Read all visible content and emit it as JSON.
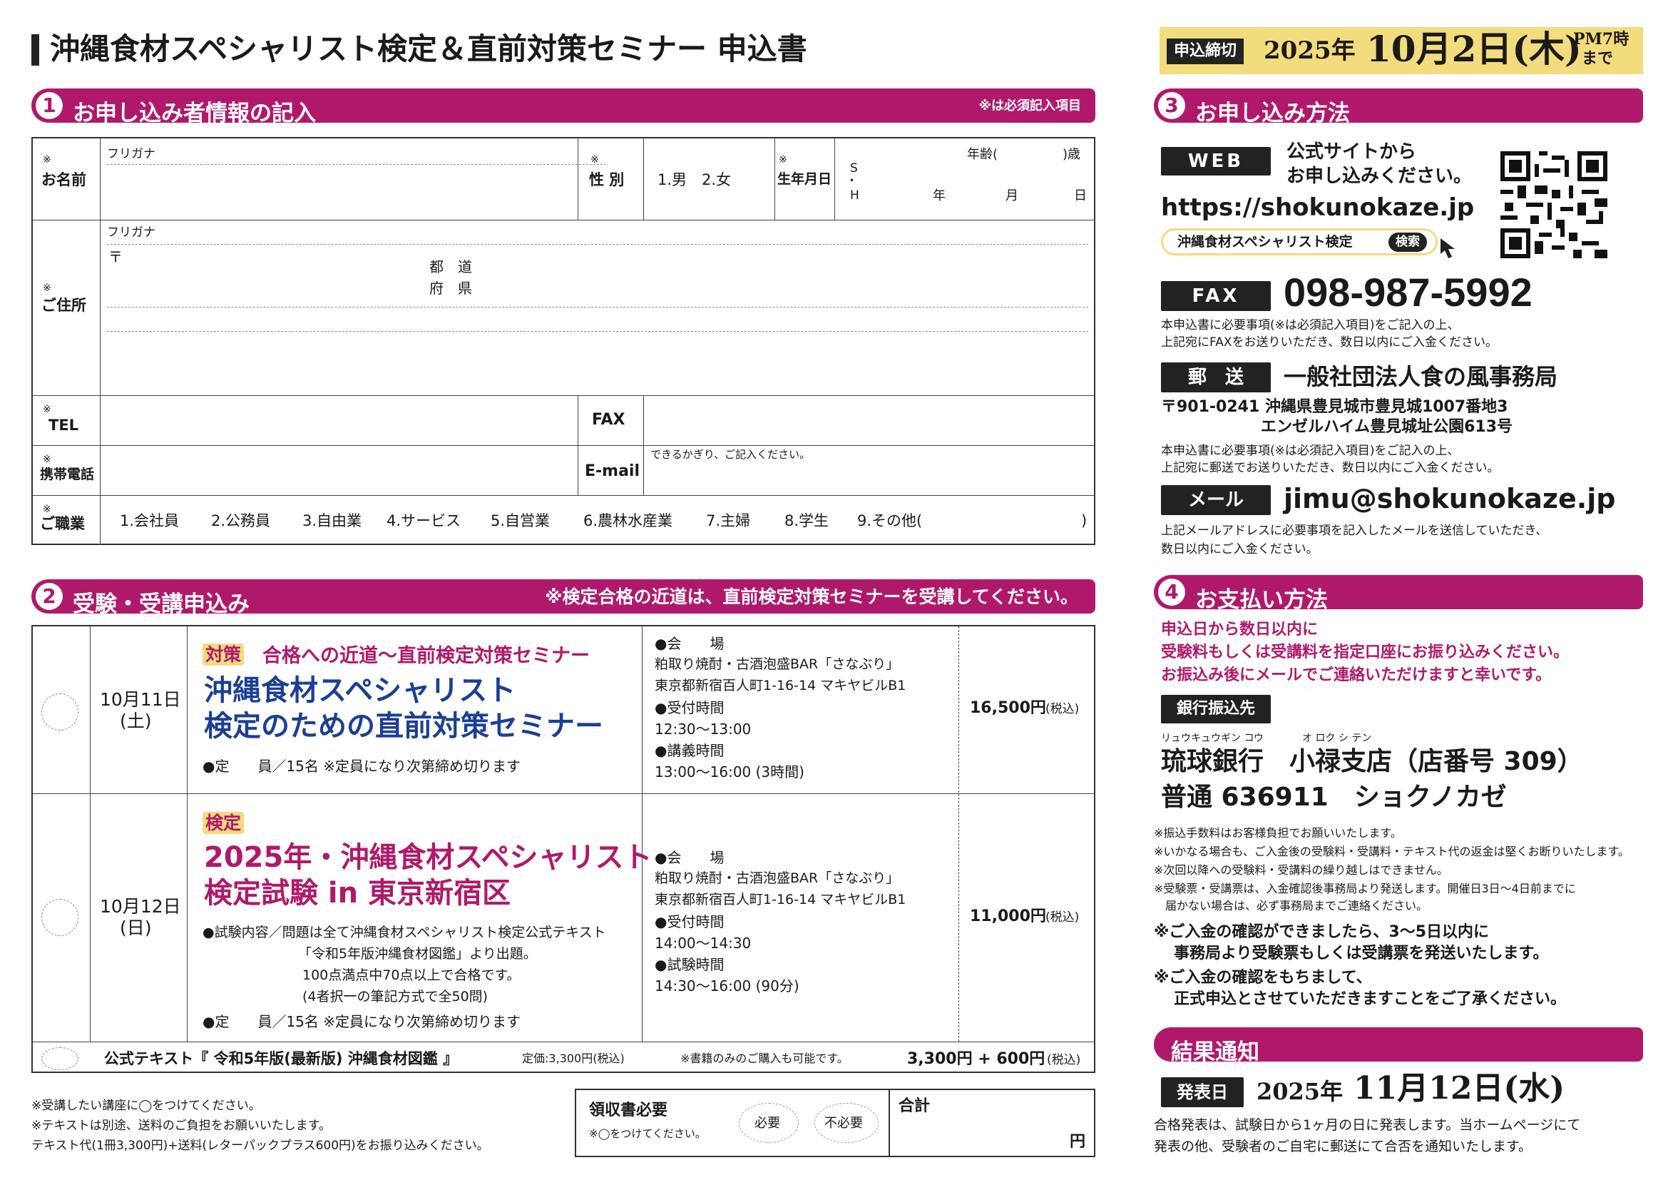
{
  "header": {
    "title": "沖縄食材スペシャリスト検定＆直前対策セミナー 申込書",
    "deadline_label": "申込締切",
    "deadline_year": "2025年",
    "deadline_date": "10月2日(木)",
    "deadline_time1": "PM7時",
    "deadline_time2": "まで"
  },
  "section1": {
    "num": "1",
    "title": "お申し込み者情報の記入",
    "note": "※は必須記入項目",
    "req_mark": "※",
    "name_label": "お名前",
    "furigana": "フリガナ",
    "gender_label": "性 別",
    "gender_options": "1.男　2.女",
    "birth_label": "生年月日",
    "birth_era1": "S",
    "birth_dot": "・",
    "birth_era2": "H",
    "age_label": "年齢(",
    "age_suffix": ")歳",
    "year": "年",
    "month": "月",
    "day": "日",
    "address_label": "ご住所",
    "postal_mark": "〒",
    "pref1": "都　道",
    "pref2": "府　県",
    "tel_label": "TEL",
    "fax_label": "FAX",
    "mobile_label": "携帯電話",
    "email_label": "E-mail",
    "email_note": "できるかぎり、ご記入ください。",
    "job_label": "ご職業",
    "jobs": [
      "1.会社員",
      "2.公務員",
      "3.自由業",
      "4.サービス",
      "5.自営業",
      "6.農林水産業",
      "7.主婦",
      "8.学生",
      "9.その他(",
      ")"
    ]
  },
  "section2": {
    "num": "2",
    "title": "受験・受講申込み",
    "note": "※検定合格の近道は、直前検定対策セミナーを受講してください。",
    "row1": {
      "date": "10月11日",
      "day": "(土)",
      "tag": "対策",
      "subtitle": "合格への近道～直前検定対策セミナー",
      "title1": "沖縄食材スペシャリスト",
      "title2": "検定のための直前対策セミナー",
      "capacity": "●定　　員／15名 ※定員になり次第締め切ります",
      "venue_label": "●会　　場",
      "venue1": "粕取り焼酎・古酒泡盛BAR「さなぶり」",
      "venue2": "東京都新宿百人町1-16-14 マキヤビルB1",
      "reception_label": "●受付時間",
      "reception": "12:30～13:00",
      "lecture_label": "●講義時間",
      "lecture": "13:00～16:00 (3時間)",
      "price": "16,500円",
      "tax": "(税込)"
    },
    "row2": {
      "date": "10月12日",
      "day": "(日)",
      "tag": "検定",
      "title1": "2025年・沖縄食材スペシャリスト",
      "title2": "検定試験 in 東京新宿区",
      "content1": "●試験内容／問題は全て沖縄食材スペシャリスト検定公式テキスト",
      "content2": "「令和5年版沖縄食材図鑑」より出題。",
      "content3": "100点満点中70点以上で合格です。",
      "content4": "(4者択一の筆記方式で全50問)",
      "capacity": "●定　　員／15名 ※定員になり次第締め切ります",
      "venue_label": "●会　　場",
      "venue1": "粕取り焼酎・古酒泡盛BAR「さなぶり」",
      "venue2": "東京都新宿百人町1-16-14 マキヤビルB1",
      "reception_label": "●受付時間",
      "reception": "14:00～14:30",
      "exam_label": "●試験時間",
      "exam": "14:30～16:00 (90分)",
      "price": "11,000円",
      "tax": "(税込)"
    },
    "row3": {
      "text": "公式テキスト『 令和5年版(最新版) 沖縄食材図鑑 』",
      "price_note": "定価:3,300円(税込)",
      "book_note": "※書籍のみのご購入も可能です。",
      "price": "3,300円 + 600円",
      "tax": "(税込)"
    },
    "foot1": "※受講したい講座に◯をつけてください。",
    "foot2": "※テキストは別途、送料のご負担をお願いいたします。",
    "foot3": "テキスト代(1冊3,300円)+送料(レターパックプラス600円)をお振り込みください。",
    "receipt_label": "領収書必要",
    "receipt_note": "※◯をつけてください。",
    "need": "必要",
    "noneed": "不必要",
    "total_label": "合計",
    "yen": "円"
  },
  "section3": {
    "num": "3",
    "title": "お申し込み方法",
    "web_label": "WEB",
    "web_text1": "公式サイトから",
    "web_text2": "お申し込みください。",
    "url": "https://shokunokaze.jp",
    "search_text": "沖縄食材スペシャリスト検定",
    "search_button": "検索",
    "fax_label": "FAX",
    "fax_number": "098-987-5992",
    "fax_note1": "本申込書に必要事項(※は必須記入項目)をご記入の上、",
    "fax_note2": "上記宛にFAXをお送りいただき、数日以内にご入金ください。",
    "mail_label": "郵　送",
    "org": "一般社団法人食の風事務局",
    "postal1": "〒901-0241 沖縄県豊見城市豊見城1007番地3",
    "postal2": "エンゼルハイム豊見城址公園613号",
    "mail_note1": "本申込書に必要事項(※は必須記入項目)をご記入の上、",
    "mail_note2": "上記宛に郵送でお送りいただき、数日以内にご入金ください。",
    "email_label": "メール",
    "email": "jimu@shokunokaze.jp",
    "email_note1": "上記メールアドレスに必要事項を記入したメールを送信していただき、",
    "email_note2": "数日以内にご入金ください。"
  },
  "section4": {
    "num": "4",
    "title": "お支払い方法",
    "lead1": "申込日から数日以内に",
    "lead2": "受験料もしくは受講料を指定口座にお振り込みください。",
    "lead3": "お振込み後にメールでご連絡いただけますと幸いです。",
    "bank_label": "銀行振込先",
    "ruby_bank": "リュウキュウギン コウ",
    "ruby_branch": "オ ロク シ テン",
    "bank_line": "琉球銀行　小禄支店（店番号 309）",
    "account_line": "普通 636911　ショクノカゼ",
    "notes": [
      "※振込手数料はお客様負担でお願いいたします。",
      "※いかなる場合も、ご入金後の受験料・受講料・テキスト代の返金は堅くお断りいたします。",
      "※次回以降への受験料・受講料の繰り越しはできません。",
      "※受験票・受講票は、入金確認後事務局より発送します。開催日3日～4日前までに",
      "　届かない場合は、必ず事務局までご連絡ください。"
    ],
    "confirm1": "※ご入金の確認ができましたら、3～5日以内に",
    "confirm2": "事務局より受験票もしくは受講票を発送いたします。",
    "confirm3": "※ご入金の確認をもちまして、",
    "confirm4": "正式申込とさせていただきますことをご了承ください。"
  },
  "results": {
    "title": "結果通知",
    "label": "発表日",
    "date_year": "2025年",
    "date": "11月12日(水)",
    "note1": "合格発表は、試験日から1ヶ月の日に発表します。当ホームページにて",
    "note2": "発表の他、受験者のご自宅に郵送にて合否を通知いたします。"
  },
  "colors": {
    "accent": "#b0196b",
    "title_blue": "#1b3f94",
    "deadline_bg": "#f2dc7d"
  }
}
